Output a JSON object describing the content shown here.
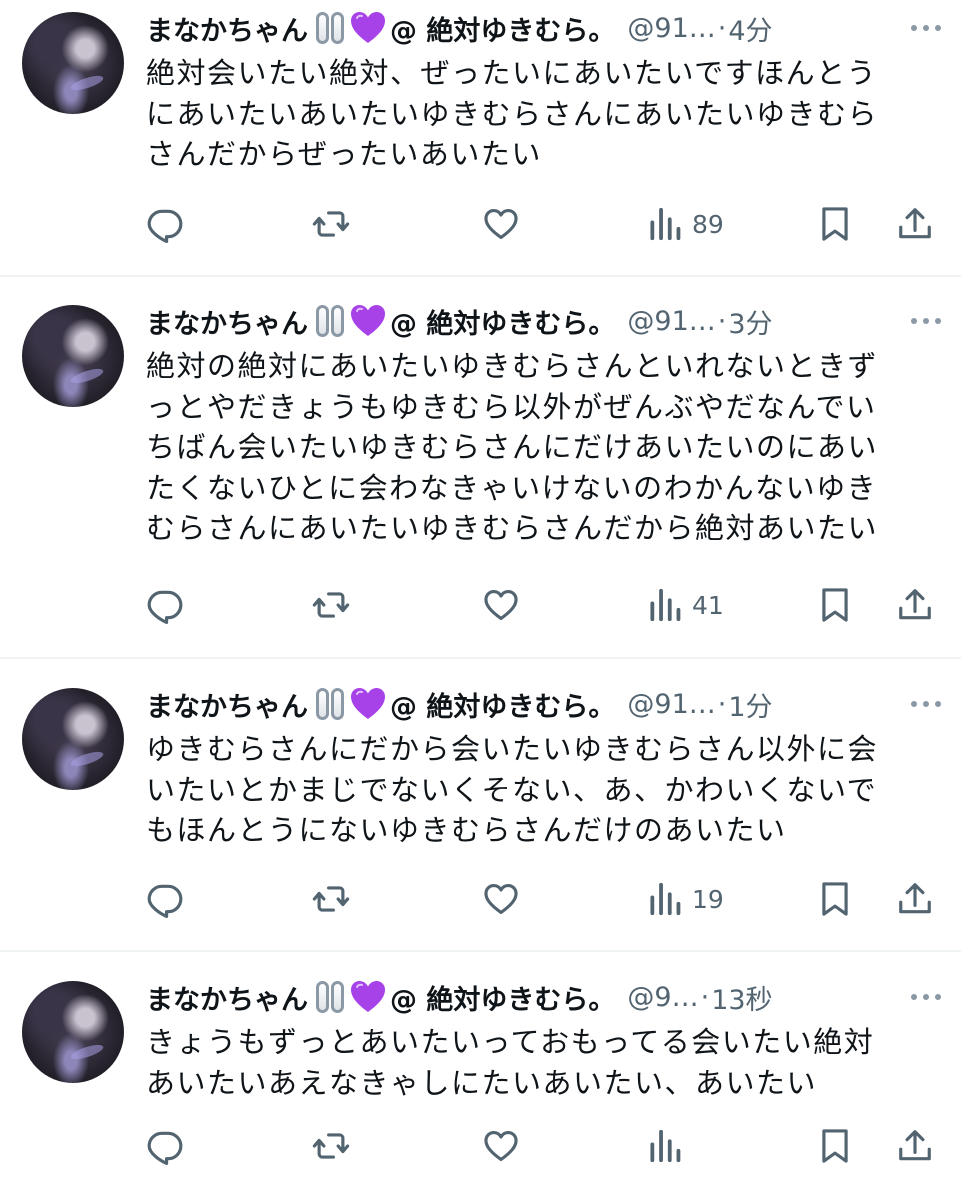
{
  "tweets": [
    {
      "name": "まなかちゃん",
      "display_suffix": "@ 絶対ゆきむら。",
      "handle": "@91…",
      "separator": "·",
      "time": "4分",
      "lines": [
        "絶対会いたい絶対、ぜったいにあいたいですほんとう",
        "にあいたいあいたいゆきむらさんにあいたいゆきむら",
        "さんだからぜったいあいたい"
      ],
      "views": "89"
    },
    {
      "name": "まなかちゃん",
      "display_suffix": "@ 絶対ゆきむら。",
      "handle": "@91…",
      "separator": "·",
      "time": "3分",
      "lines": [
        "絶対の絶対にあいたいゆきむらさんといれないときず",
        "っとやだきょうもゆきむら以外がぜんぶやだなんでい",
        "ちばん会いたいゆきむらさんにだけあいたいのにあい",
        "たくないひとに会わなきゃいけないのわかんないゆき",
        "むらさんにあいたいゆきむらさんだから絶対あいたい"
      ],
      "views": "41"
    },
    {
      "name": "まなかちゃん",
      "display_suffix": "@ 絶対ゆきむら。",
      "handle": "@91…",
      "separator": "·",
      "time": "1分",
      "lines": [
        "ゆきむらさんにだから会いたいゆきむらさん以外に会",
        "いたいとかまじでないくそない、あ、かわいくないで",
        "もほんとうにないゆきむらさんだけのあいたい"
      ],
      "views": "19"
    },
    {
      "name": "まなかちゃん",
      "display_suffix": "@ 絶対ゆきむら。",
      "handle": "@9…",
      "separator": "·",
      "time": "13秒",
      "lines": [
        "きょうもずっとあいたいっておもってる会いたい絶対",
        "あいたいあえなきゃしにたいあいたい、あいたい"
      ],
      "views": ""
    }
  ],
  "colors": {
    "text": "#0f1419",
    "secondary": "#536471",
    "icon": "#536471",
    "divider": "#eff3f4",
    "heart_emoji": "#a742e8"
  },
  "icons": {
    "emoji": [
      "chain-emoji",
      "purple-heart-emoji"
    ],
    "actions": [
      "reply-icon",
      "retweet-icon",
      "like-icon",
      "views-icon",
      "bookmark-icon",
      "share-icon"
    ],
    "menu": "more-icon"
  }
}
